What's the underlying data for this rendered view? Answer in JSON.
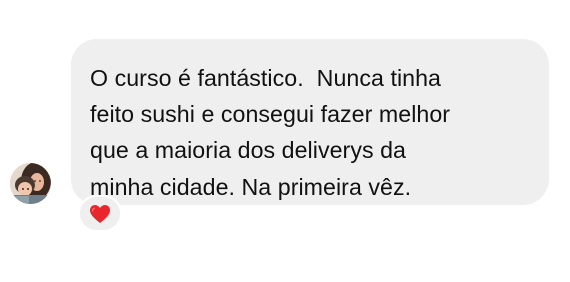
{
  "message": {
    "text": "O curso é fantástico.  Nunca tinha\nfeito sushi e consegui fazer melhor\nque a maioria dos deliverys da\nminha cidade. Na primeira vêz.",
    "bubble_color": "#efefef",
    "text_color": "#111111"
  },
  "reaction": {
    "icon": "red-heart-icon",
    "color": "#e8262c"
  },
  "avatar": {
    "icon": "profile-photo-avatar"
  }
}
